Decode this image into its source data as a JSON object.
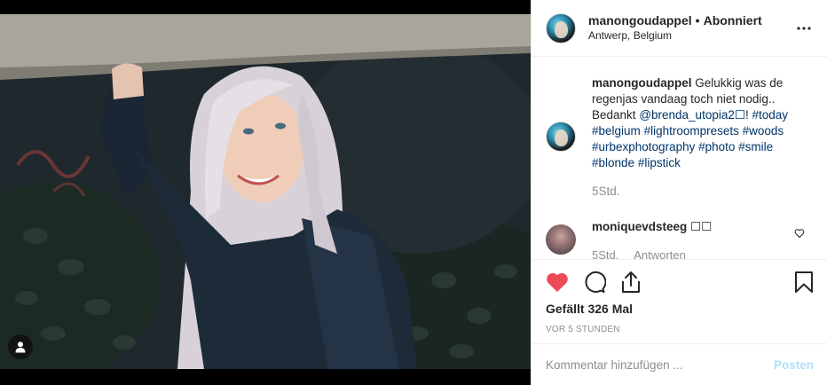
{
  "post": {
    "author": "manongoudappel",
    "follow_status": "Abonniert",
    "location": "Antwerp, Belgium",
    "caption": {
      "text": "Gelukkig was de regenjas vandaag toch niet nodig.. Bedankt",
      "mention": "@brenda_utopia2☐",
      "tags": [
        "#today",
        "#belgium",
        "#lightroompresets",
        "#woods",
        "#urbexphotography",
        "#photo",
        "#smile",
        "#blonde",
        "#lipstick"
      ],
      "time": "5Std."
    },
    "comments": [
      {
        "author": "moniquevdsteeg",
        "text": "☐☐",
        "time": "5Std.",
        "reply": "Antworten"
      }
    ],
    "likes": "Gefällt 326 Mal",
    "posted_ago": "VOR 5 STUNDEN"
  },
  "composer": {
    "placeholder": "Kommentar hinzufügen ...",
    "post_label": "Posten"
  },
  "colors": {
    "like_red": "#ed4956",
    "link_blue": "#003569",
    "post_button_disabled": "#b2dffc",
    "muted_text": "#8e8e8e"
  },
  "icons": [
    "more-options-icon",
    "heart-filled-icon",
    "comment-icon",
    "share-icon",
    "bookmark-icon",
    "heart-outline-icon",
    "tagged-user-icon"
  ]
}
